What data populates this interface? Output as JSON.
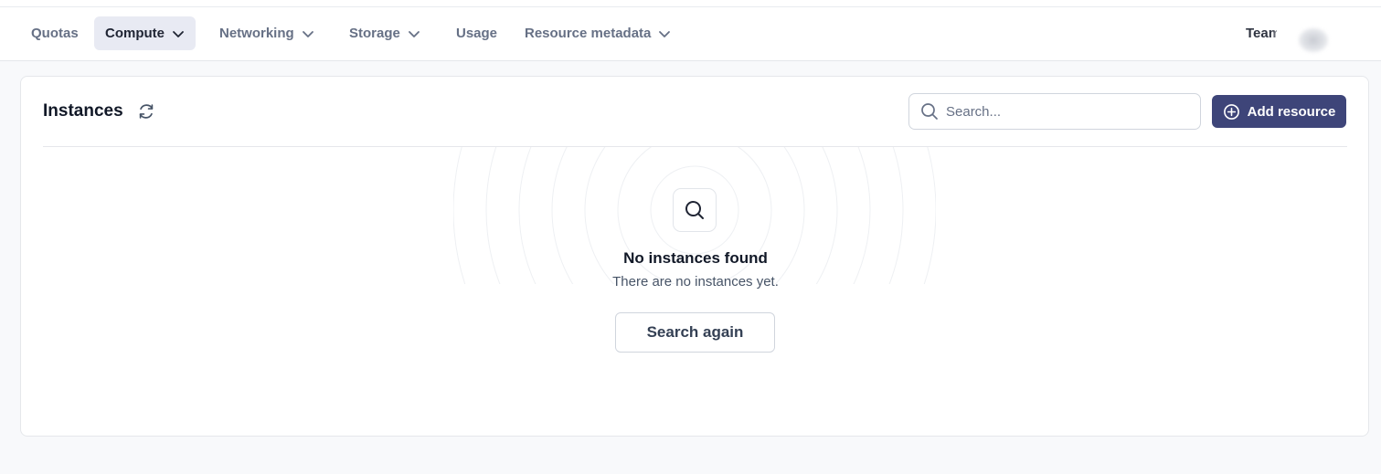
{
  "nav": {
    "items": [
      {
        "label": "Quotas",
        "dropdown": false,
        "active": false
      },
      {
        "label": "Compute",
        "dropdown": true,
        "active": true
      },
      {
        "label": "Networking",
        "dropdown": true,
        "active": false
      },
      {
        "label": "Storage",
        "dropdown": true,
        "active": false
      },
      {
        "label": "Usage",
        "dropdown": false,
        "active": false
      },
      {
        "label": "Resource metadata",
        "dropdown": true,
        "active": false
      }
    ],
    "team_label": "Team"
  },
  "panel": {
    "title": "Instances",
    "search_placeholder": "Search...",
    "add_button": "Add resource"
  },
  "empty_state": {
    "title": "No instances found",
    "subtitle": "There are no instances yet.",
    "button": "Search again"
  },
  "icons": {
    "refresh": "refresh-icon",
    "search": "search-icon",
    "add": "plus-circle-icon",
    "chevron": "chevron-down-icon"
  },
  "colors": {
    "primary": "#3e4579",
    "active_tab_bg": "#e8eaf3",
    "page_bg": "#f8f9fb"
  }
}
